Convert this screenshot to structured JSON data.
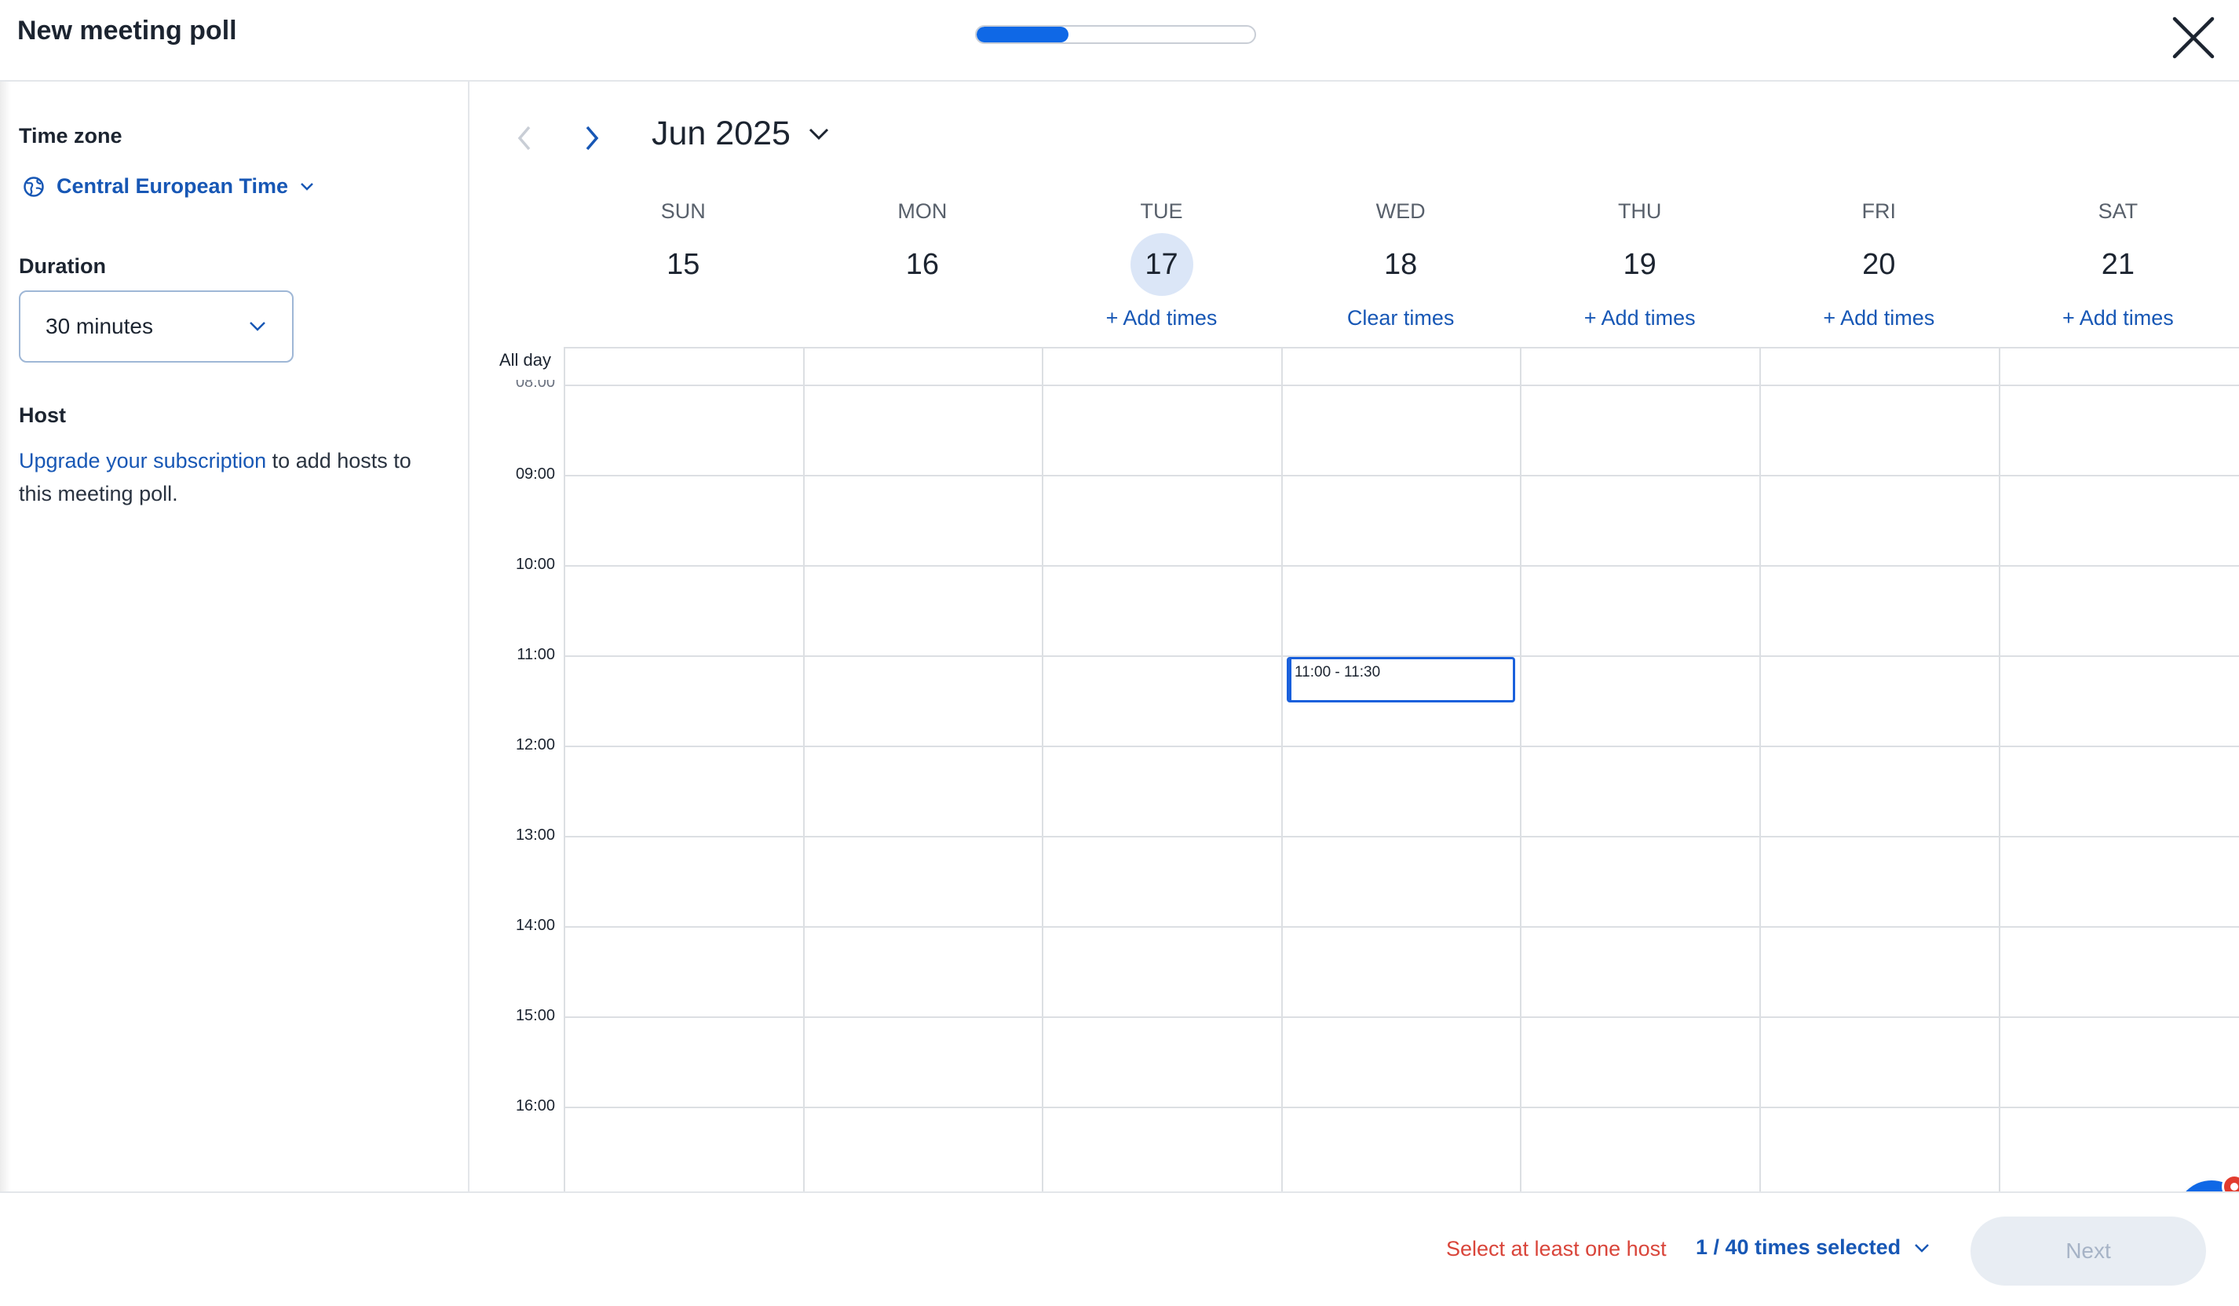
{
  "header": {
    "title": "New meeting poll",
    "progress": 0.33
  },
  "sidebar": {
    "timezone_label": "Time zone",
    "timezone_value": "Central European Time",
    "duration_label": "Duration",
    "duration_value": "30 minutes",
    "host_label": "Host",
    "host_link": "Upgrade your subscription",
    "host_text": " to add hosts to this meeting poll."
  },
  "calendar": {
    "month": "Jun 2025",
    "days": [
      {
        "dow": "SUN",
        "num": "15",
        "action": "",
        "today": false
      },
      {
        "dow": "MON",
        "num": "16",
        "action": "",
        "today": false
      },
      {
        "dow": "TUE",
        "num": "17",
        "action": "+ Add times",
        "today": true
      },
      {
        "dow": "WED",
        "num": "18",
        "action": "Clear times",
        "today": false
      },
      {
        "dow": "THU",
        "num": "19",
        "action": "+ Add times",
        "today": false
      },
      {
        "dow": "FRI",
        "num": "20",
        "action": "+ Add times",
        "today": false
      },
      {
        "dow": "SAT",
        "num": "21",
        "action": "+ Add times",
        "today": false
      }
    ],
    "all_day": "All day",
    "times": [
      "08:00",
      "09:00",
      "10:00",
      "11:00",
      "12:00",
      "13:00",
      "14:00",
      "15:00",
      "16:00"
    ],
    "event": {
      "label": "11:00 - 11:30"
    }
  },
  "footer": {
    "warning": "Select at least one host",
    "count": "1 / 40 times selected",
    "next_label": "Next"
  },
  "colors": {
    "accent": "#0f68e6",
    "link": "#1757b5",
    "warning": "#d9453a",
    "badge": "#e23b2e"
  }
}
